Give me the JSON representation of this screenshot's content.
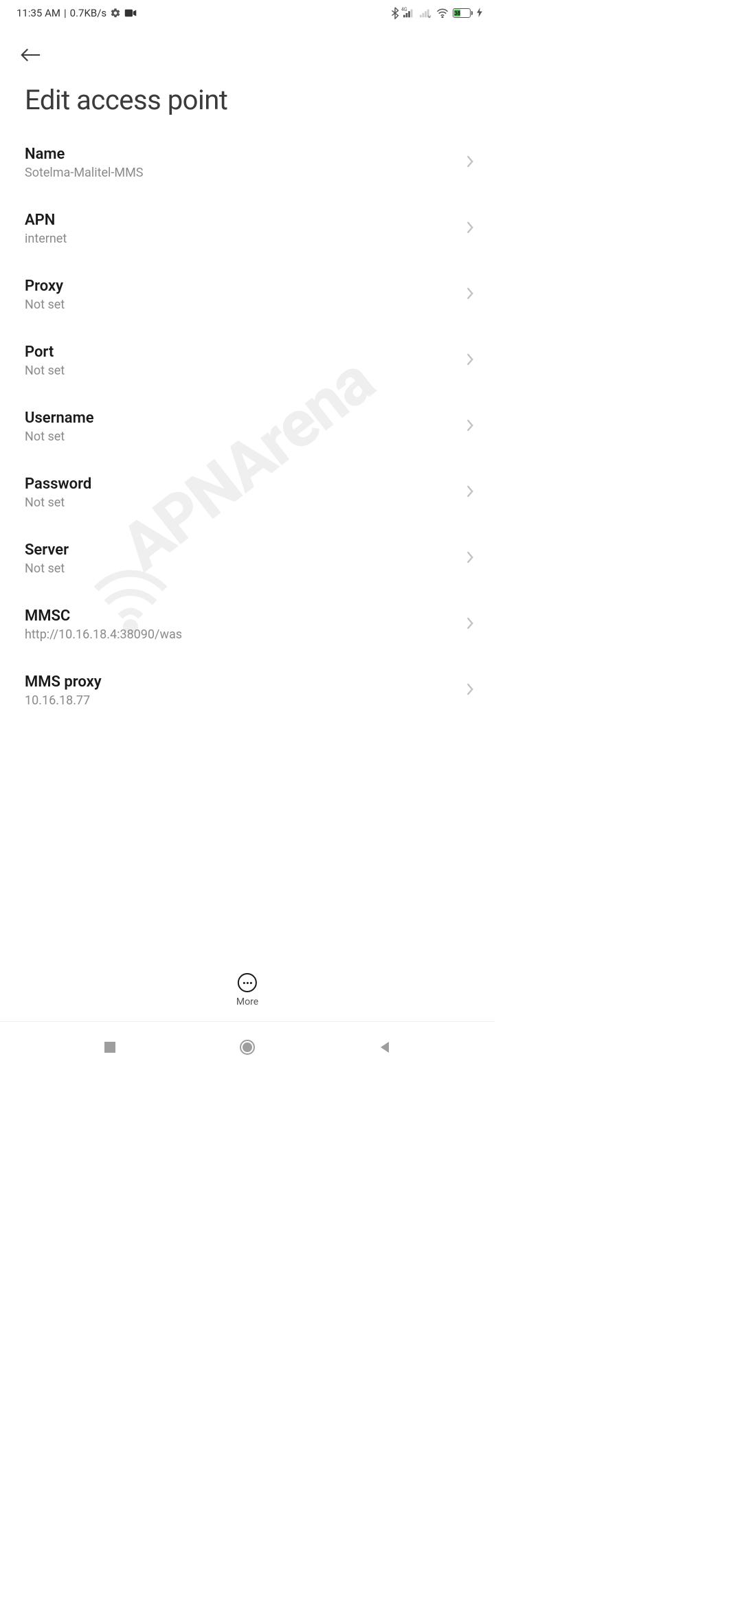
{
  "status": {
    "time": "11:35 AM",
    "sep": "|",
    "speed": "0.7KB/s",
    "battery_percent": "38",
    "network_badge": "4G"
  },
  "page": {
    "title": "Edit access point"
  },
  "list": [
    {
      "label": "Name",
      "value": "Sotelma-Malitel-MMS"
    },
    {
      "label": "APN",
      "value": "internet"
    },
    {
      "label": "Proxy",
      "value": "Not set"
    },
    {
      "label": "Port",
      "value": "Not set"
    },
    {
      "label": "Username",
      "value": "Not set"
    },
    {
      "label": "Password",
      "value": "Not set"
    },
    {
      "label": "Server",
      "value": "Not set"
    },
    {
      "label": "MMSC",
      "value": "http://10.16.18.4:38090/was"
    },
    {
      "label": "MMS proxy",
      "value": "10.16.18.77"
    }
  ],
  "more": {
    "label": "More"
  },
  "watermark": {
    "text": "APNArena"
  }
}
